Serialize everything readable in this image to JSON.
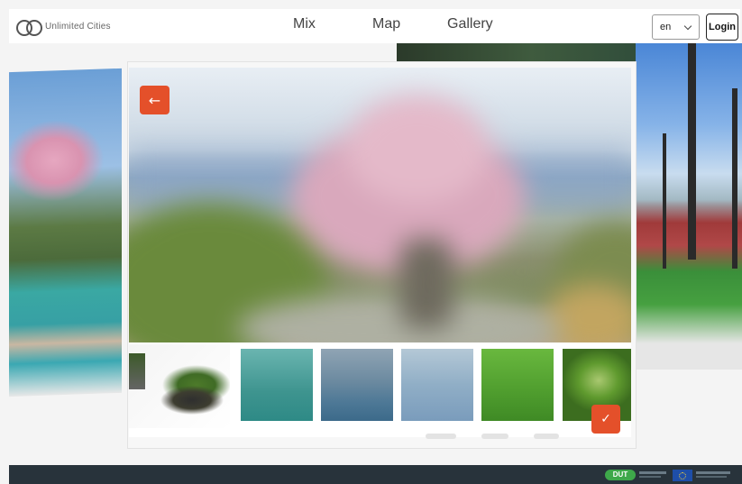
{
  "header": {
    "logo_text": "Unlimited Cities",
    "nav": {
      "mix": "Mix",
      "map": "Map",
      "gallery": "Gallery"
    },
    "language": {
      "selected": "en"
    },
    "login_label": "Login"
  },
  "modal": {
    "back_symbol": "←",
    "confirm_symbol": "✓",
    "thumbnails": [
      {
        "name": "island-planter"
      },
      {
        "name": "turquoise-water"
      },
      {
        "name": "reflective-water"
      },
      {
        "name": "rippled-water"
      },
      {
        "name": "green-grass"
      },
      {
        "name": "vignette-grass"
      }
    ]
  },
  "footer": {
    "dut_logo_text": "DUT"
  },
  "colors": {
    "accent": "#e4502a",
    "footer_bg": "#28333b",
    "dut_green": "#3ea84a",
    "eu_blue": "#1e4ea8"
  },
  "icons": {
    "logo": "infinity-icon",
    "back": "arrow-left-icon",
    "confirm": "check-icon",
    "dropdown": "chevron-down-icon"
  }
}
